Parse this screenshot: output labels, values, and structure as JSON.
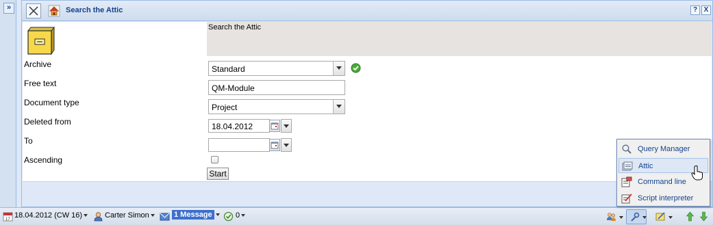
{
  "window": {
    "title": "Search the Attic",
    "help_button": "?",
    "close_button": "X",
    "expand_button": "»"
  },
  "form": {
    "header_text": "Search the Attic",
    "fields": {
      "archive": {
        "label": "Archive",
        "value": "Standard"
      },
      "free_text": {
        "label": "Free text",
        "value": "QM-Module"
      },
      "document_type": {
        "label": "Document type",
        "value": "Project"
      },
      "deleted_from": {
        "label": "Deleted from",
        "value": "18.04.2012"
      },
      "to": {
        "label": "To",
        "value": ""
      },
      "ascending": {
        "label": "Ascending",
        "checked": false
      }
    },
    "start_button": "Start"
  },
  "status_bar": {
    "date": "18.04.2012 (CW 16)",
    "user": "Carter Simon",
    "messages": "1 Message",
    "tasks": "0"
  },
  "popup_menu": {
    "items": [
      {
        "label": "Query Manager",
        "icon": "magnifier-icon"
      },
      {
        "label": "Attic",
        "icon": "attic-icon",
        "active": true
      },
      {
        "label": "Command line",
        "icon": "command-line-icon"
      },
      {
        "label": "Script interpreter",
        "icon": "script-icon"
      }
    ]
  },
  "colors": {
    "title_text": "#15428b",
    "panel_border": "#99bbe8",
    "message_highlight": "#3d6fcc"
  }
}
